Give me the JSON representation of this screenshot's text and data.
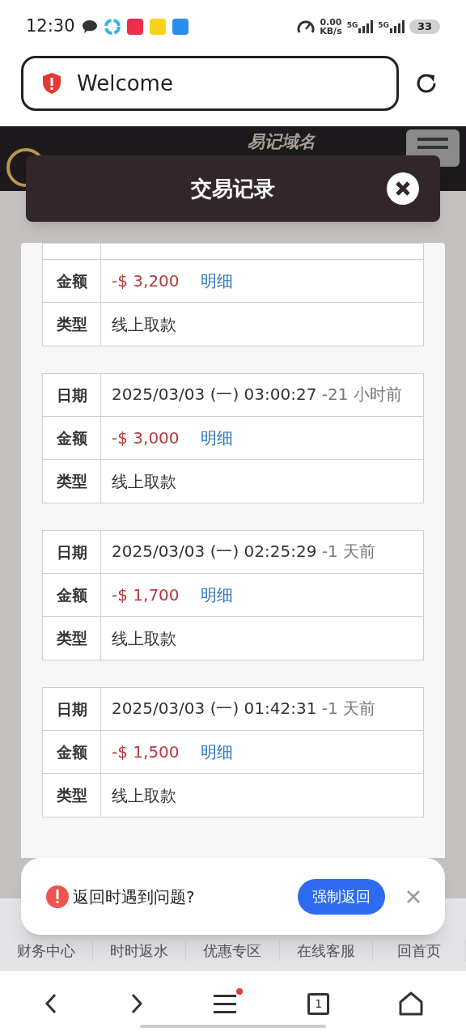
{
  "status_bar": {
    "time": "12:30",
    "net_speed_value": "0.00",
    "net_speed_unit": "KB/s",
    "signal_1": "5G",
    "signal_2": "5G",
    "battery": "33"
  },
  "address_bar": {
    "title": "Welcome"
  },
  "site_header": {
    "domain_label": "易记域名"
  },
  "modal": {
    "title": "交易记录"
  },
  "records": [
    {
      "rows_labels": [
        "金额",
        "类型"
      ],
      "amount": "-$ 3,200",
      "detail": "明细",
      "type": "线上取款"
    },
    {
      "date": "2025/03/03 (一) 03:00:27",
      "relative": "-21 小时前",
      "rows_labels": [
        "日期",
        "金额",
        "类型"
      ],
      "amount": "-$ 3,000",
      "detail": "明细",
      "type": "线上取款"
    },
    {
      "date": "2025/03/03 (一) 02:25:29",
      "relative": "-1 天前",
      "rows_labels": [
        "日期",
        "金额",
        "类型"
      ],
      "amount": "-$ 1,700",
      "detail": "明细",
      "type": "线上取款"
    },
    {
      "date": "2025/03/03 (一) 01:42:31",
      "relative": "-1 天前",
      "rows_labels": [
        "日期",
        "金额",
        "类型"
      ],
      "amount": "-$ 1,500",
      "detail": "明细",
      "type": "线上取款"
    }
  ],
  "toast": {
    "message": "返回时遇到问题?",
    "button": "强制返回"
  },
  "site_nav": [
    "财务中心",
    "时时返水",
    "优惠专区",
    "在线客服",
    "回首页"
  ],
  "browser_bar": {
    "tab_count": "1",
    "menu_badge": true
  }
}
